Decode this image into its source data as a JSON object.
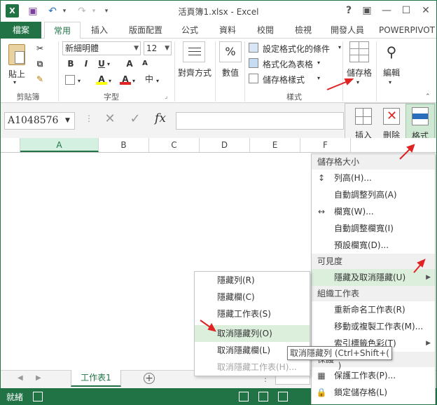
{
  "window": {
    "title": "活頁簿1.xlsx - Excel",
    "help": "?",
    "ribbon_display": "▣",
    "minimize": "—",
    "maximize": "☐",
    "close": "✕"
  },
  "app_logo": "X",
  "qat": {
    "save": "💾",
    "undo": "↶",
    "redo": "↷",
    "customize": "▾"
  },
  "tabs": [
    "檔案",
    "常用",
    "插入",
    "版面配置",
    "公式",
    "資料",
    "校閱",
    "檢視",
    "開發人員",
    "POWERPIVOT"
  ],
  "ribbon": {
    "clipboard": {
      "paste_label": "貼上",
      "group_label": "剪貼簿"
    },
    "font": {
      "name": "新細明體",
      "size": "12",
      "bold": "B",
      "italic": "I",
      "underline": "U",
      "grow": "A",
      "shrink": "A",
      "fill": "A",
      "color": "A",
      "phonetic": "中",
      "group_label": "字型"
    },
    "alignment": {
      "label": "對齊方式"
    },
    "number": {
      "label": "數值",
      "symbol": "%"
    },
    "styles": {
      "conditional": "設定格式化的條件",
      "as_table": "格式化為表格",
      "cell_styles": "儲存格樣式",
      "group_label": "樣式"
    },
    "cells": {
      "label": "儲存格"
    },
    "editing": {
      "label": "編輯"
    }
  },
  "cells_panel": {
    "insert": "插入",
    "delete": "刪除",
    "format": "格式"
  },
  "namebox": "A1048576",
  "formula_icons": {
    "cancel": "✕",
    "enter": "✓",
    "fx": "fx"
  },
  "columns": [
    "A",
    "B",
    "C",
    "D",
    "E",
    "F"
  ],
  "format_menu": {
    "sections": {
      "cell_size": "儲存格大小",
      "visibility": "可見度",
      "organize": "組織工作表",
      "protection": "保護"
    },
    "items": {
      "row_height": "列高(H)...",
      "autofit_row": "自動調整列高(A)",
      "col_width": "欄寬(W)...",
      "autofit_col": "自動調整欄寬(I)",
      "default_width": "預設欄寬(D)...",
      "hide_unhide": "隱藏及取消隱藏(U)",
      "rename": "重新命名工作表(R)",
      "move_copy": "移動或複製工作表(M)...",
      "tab_color": "索引標籤色彩(T)",
      "protect_sheet": "保護工作表(P)...",
      "lock_cell": "鎖定儲存格(L)"
    }
  },
  "hide_submenu": {
    "hide_rows": "隱藏列(R)",
    "hide_cols": "隱藏欄(C)",
    "hide_sheet": "隱藏工作表(S)",
    "unhide_rows": "取消隱藏列(O)",
    "unhide_cols": "取消隱藏欄(L)",
    "unhide_sheet": "取消隱藏工作表(H)..."
  },
  "tooltip": "取消隱藏列 (Ctrl+Shift+( )",
  "sheet_tab": "工作表1",
  "status": {
    "ready": "就緒"
  },
  "colors": {
    "accent": "#217346",
    "highlight": "#dcefdd",
    "arrow": "#e02424"
  }
}
